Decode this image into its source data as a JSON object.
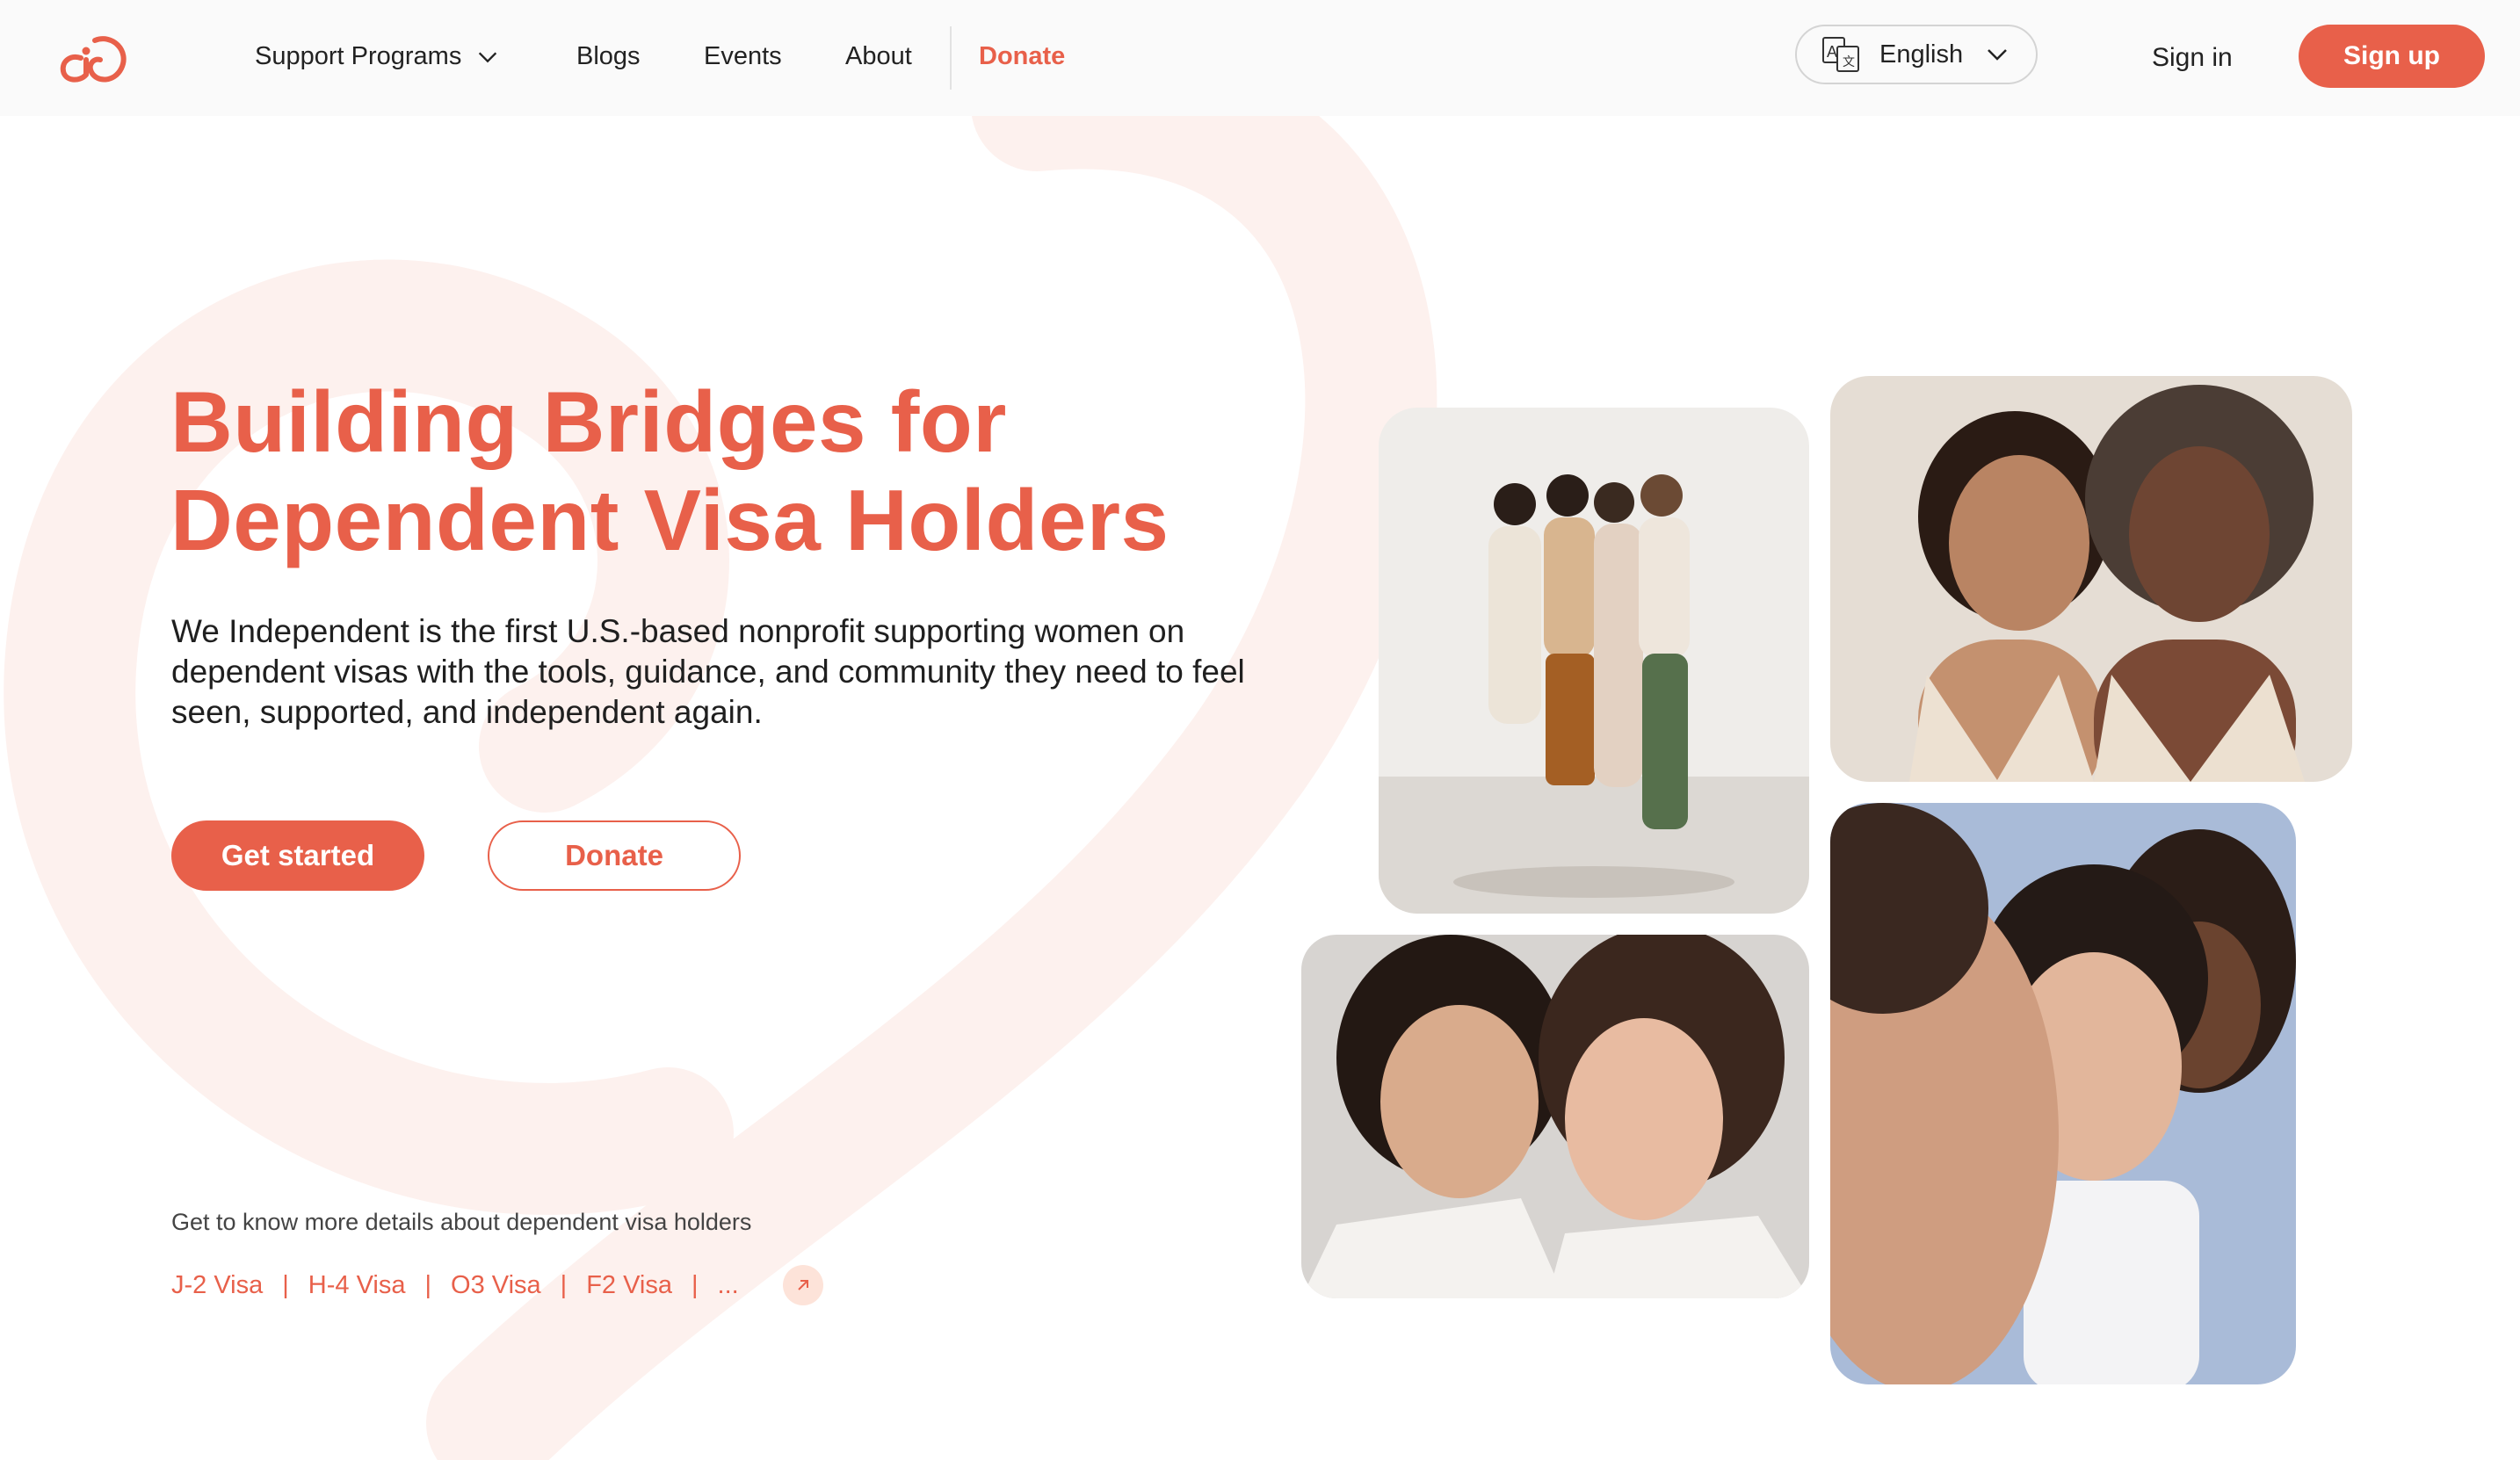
{
  "nav": {
    "support_programs": "Support Programs",
    "blogs": "Blogs",
    "events": "Events",
    "about": "About",
    "donate": "Donate"
  },
  "language": {
    "selected": "English"
  },
  "auth": {
    "sign_in": "Sign in",
    "sign_up": "Sign up"
  },
  "hero": {
    "title_line1": "Building Bridges for",
    "title_line2": "Dependent Visa Holders",
    "description": "We Independent is the first U.S.-based nonprofit supporting women on dependent visas with the tools, guidance, and community they need to feel seen, supported, and independent again.",
    "primary_cta": "Get started",
    "secondary_cta": "Donate"
  },
  "visa_info": {
    "intro": "Get to know more details about dependent visa holders",
    "links": [
      "J-2 Visa",
      "H-4 Visa",
      "O3 Visa",
      "F2 Visa",
      "..."
    ],
    "separator": "|"
  },
  "colors": {
    "brand": "#e8604a",
    "brand_light": "#fde3d9",
    "text": "#1f1f1f"
  },
  "icons": {
    "logo": "we-independent-logo",
    "dropdown": "chevron-down-icon",
    "language": "translate-icon",
    "external": "arrow-up-right-icon"
  }
}
